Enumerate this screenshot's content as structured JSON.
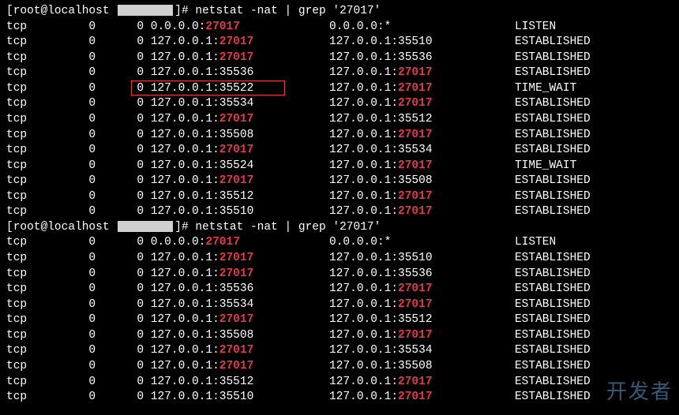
{
  "prompt1": {
    "user": "root",
    "host": "localhost",
    "redacted": true,
    "cmd": "netstat -nat | grep '27017'"
  },
  "rows1": [
    {
      "proto": "tcp",
      "recv": "0",
      "send": "0",
      "local_ip": "0.0.0.0",
      "local_port": "27017",
      "local_hl": true,
      "foreign_ip": "0.0.0.0",
      "foreign_port": "*",
      "foreign_hl": false,
      "state": "LISTEN"
    },
    {
      "proto": "tcp",
      "recv": "0",
      "send": "0",
      "local_ip": "127.0.0.1",
      "local_port": "27017",
      "local_hl": true,
      "foreign_ip": "127.0.0.1",
      "foreign_port": "35510",
      "foreign_hl": false,
      "state": "ESTABLISHED"
    },
    {
      "proto": "tcp",
      "recv": "0",
      "send": "0",
      "local_ip": "127.0.0.1",
      "local_port": "27017",
      "local_hl": true,
      "foreign_ip": "127.0.0.1",
      "foreign_port": "35536",
      "foreign_hl": false,
      "state": "ESTABLISHED"
    },
    {
      "proto": "tcp",
      "recv": "0",
      "send": "0",
      "local_ip": "127.0.0.1",
      "local_port": "35536",
      "local_hl": false,
      "foreign_ip": "127.0.0.1",
      "foreign_port": "27017",
      "foreign_hl": true,
      "state": "ESTABLISHED"
    },
    {
      "proto": "tcp",
      "recv": "0",
      "send": "0",
      "local_ip": "127.0.0.1",
      "local_port": "35522",
      "local_hl": false,
      "foreign_ip": "127.0.0.1",
      "foreign_port": "27017",
      "foreign_hl": true,
      "state": "TIME_WAIT",
      "boxed": true
    },
    {
      "proto": "tcp",
      "recv": "0",
      "send": "0",
      "local_ip": "127.0.0.1",
      "local_port": "35534",
      "local_hl": false,
      "foreign_ip": "127.0.0.1",
      "foreign_port": "27017",
      "foreign_hl": true,
      "state": "ESTABLISHED"
    },
    {
      "proto": "tcp",
      "recv": "0",
      "send": "0",
      "local_ip": "127.0.0.1",
      "local_port": "27017",
      "local_hl": true,
      "foreign_ip": "127.0.0.1",
      "foreign_port": "35512",
      "foreign_hl": false,
      "state": "ESTABLISHED"
    },
    {
      "proto": "tcp",
      "recv": "0",
      "send": "0",
      "local_ip": "127.0.0.1",
      "local_port": "35508",
      "local_hl": false,
      "foreign_ip": "127.0.0.1",
      "foreign_port": "27017",
      "foreign_hl": true,
      "state": "ESTABLISHED"
    },
    {
      "proto": "tcp",
      "recv": "0",
      "send": "0",
      "local_ip": "127.0.0.1",
      "local_port": "27017",
      "local_hl": true,
      "foreign_ip": "127.0.0.1",
      "foreign_port": "35534",
      "foreign_hl": false,
      "state": "ESTABLISHED"
    },
    {
      "proto": "tcp",
      "recv": "0",
      "send": "0",
      "local_ip": "127.0.0.1",
      "local_port": "35524",
      "local_hl": false,
      "foreign_ip": "127.0.0.1",
      "foreign_port": "27017",
      "foreign_hl": true,
      "state": "TIME_WAIT"
    },
    {
      "proto": "tcp",
      "recv": "0",
      "send": "0",
      "local_ip": "127.0.0.1",
      "local_port": "27017",
      "local_hl": true,
      "foreign_ip": "127.0.0.1",
      "foreign_port": "35508",
      "foreign_hl": false,
      "state": "ESTABLISHED"
    },
    {
      "proto": "tcp",
      "recv": "0",
      "send": "0",
      "local_ip": "127.0.0.1",
      "local_port": "35512",
      "local_hl": false,
      "foreign_ip": "127.0.0.1",
      "foreign_port": "27017",
      "foreign_hl": true,
      "state": "ESTABLISHED"
    },
    {
      "proto": "tcp",
      "recv": "0",
      "send": "0",
      "local_ip": "127.0.0.1",
      "local_port": "35510",
      "local_hl": false,
      "foreign_ip": "127.0.0.1",
      "foreign_port": "27017",
      "foreign_hl": true,
      "state": "ESTABLISHED"
    }
  ],
  "prompt2": {
    "user": "root",
    "host": "localhost",
    "redacted": true,
    "cmd": "netstat -nat | grep '27017'"
  },
  "rows2": [
    {
      "proto": "tcp",
      "recv": "0",
      "send": "0",
      "local_ip": "0.0.0.0",
      "local_port": "27017",
      "local_hl": true,
      "foreign_ip": "0.0.0.0",
      "foreign_port": "*",
      "foreign_hl": false,
      "state": "LISTEN"
    },
    {
      "proto": "tcp",
      "recv": "0",
      "send": "0",
      "local_ip": "127.0.0.1",
      "local_port": "27017",
      "local_hl": true,
      "foreign_ip": "127.0.0.1",
      "foreign_port": "35510",
      "foreign_hl": false,
      "state": "ESTABLISHED"
    },
    {
      "proto": "tcp",
      "recv": "0",
      "send": "0",
      "local_ip": "127.0.0.1",
      "local_port": "27017",
      "local_hl": true,
      "foreign_ip": "127.0.0.1",
      "foreign_port": "35536",
      "foreign_hl": false,
      "state": "ESTABLISHED"
    },
    {
      "proto": "tcp",
      "recv": "0",
      "send": "0",
      "local_ip": "127.0.0.1",
      "local_port": "35536",
      "local_hl": false,
      "foreign_ip": "127.0.0.1",
      "foreign_port": "27017",
      "foreign_hl": true,
      "state": "ESTABLISHED"
    },
    {
      "proto": "tcp",
      "recv": "0",
      "send": "0",
      "local_ip": "127.0.0.1",
      "local_port": "35534",
      "local_hl": false,
      "foreign_ip": "127.0.0.1",
      "foreign_port": "27017",
      "foreign_hl": true,
      "state": "ESTABLISHED"
    },
    {
      "proto": "tcp",
      "recv": "0",
      "send": "0",
      "local_ip": "127.0.0.1",
      "local_port": "27017",
      "local_hl": true,
      "foreign_ip": "127.0.0.1",
      "foreign_port": "35512",
      "foreign_hl": false,
      "state": "ESTABLISHED"
    },
    {
      "proto": "tcp",
      "recv": "0",
      "send": "0",
      "local_ip": "127.0.0.1",
      "local_port": "35508",
      "local_hl": false,
      "foreign_ip": "127.0.0.1",
      "foreign_port": "27017",
      "foreign_hl": true,
      "state": "ESTABLISHED"
    },
    {
      "proto": "tcp",
      "recv": "0",
      "send": "0",
      "local_ip": "127.0.0.1",
      "local_port": "27017",
      "local_hl": true,
      "foreign_ip": "127.0.0.1",
      "foreign_port": "35534",
      "foreign_hl": false,
      "state": "ESTABLISHED"
    },
    {
      "proto": "tcp",
      "recv": "0",
      "send": "0",
      "local_ip": "127.0.0.1",
      "local_port": "27017",
      "local_hl": true,
      "foreign_ip": "127.0.0.1",
      "foreign_port": "35508",
      "foreign_hl": false,
      "state": "ESTABLISHED"
    },
    {
      "proto": "tcp",
      "recv": "0",
      "send": "0",
      "local_ip": "127.0.0.1",
      "local_port": "35512",
      "local_hl": false,
      "foreign_ip": "127.0.0.1",
      "foreign_port": "27017",
      "foreign_hl": true,
      "state": "ESTABLISHED"
    },
    {
      "proto": "tcp",
      "recv": "0",
      "send": "0",
      "local_ip": "127.0.0.1",
      "local_port": "35510",
      "local_hl": false,
      "foreign_ip": "127.0.0.1",
      "foreign_port": "27017",
      "foreign_hl": true,
      "state": "ESTABLISHED",
      "cs": true
    }
  ],
  "watermark": "开发者"
}
